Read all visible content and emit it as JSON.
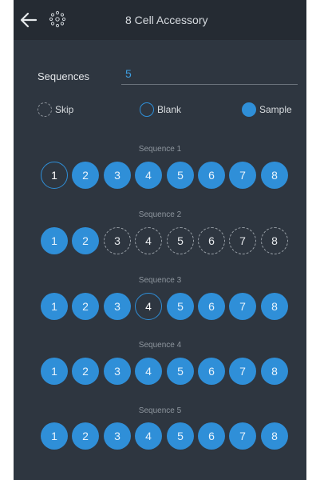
{
  "header": {
    "title": "8 Cell Accessory",
    "back_icon": "arrow-left-icon",
    "app_icon": "carousel-icon"
  },
  "sequences_field": {
    "label": "Sequences",
    "value": "5"
  },
  "legend": [
    {
      "state": "skip",
      "label": "Skip"
    },
    {
      "state": "blank",
      "label": "Blank"
    },
    {
      "state": "sample",
      "label": "Sample"
    }
  ],
  "colors": {
    "accent": "#2f8fd8",
    "background": "#2e3640",
    "topbar": "#252b33"
  },
  "sequences": [
    {
      "title": "Sequence  1",
      "cells": [
        {
          "label": "1",
          "state": "blank"
        },
        {
          "label": "2",
          "state": "sample"
        },
        {
          "label": "3",
          "state": "sample"
        },
        {
          "label": "4",
          "state": "sample"
        },
        {
          "label": "5",
          "state": "sample"
        },
        {
          "label": "6",
          "state": "sample"
        },
        {
          "label": "7",
          "state": "sample"
        },
        {
          "label": "8",
          "state": "sample"
        }
      ]
    },
    {
      "title": "Sequence  2",
      "cells": [
        {
          "label": "1",
          "state": "sample"
        },
        {
          "label": "2",
          "state": "sample"
        },
        {
          "label": "3",
          "state": "skip"
        },
        {
          "label": "4",
          "state": "skip"
        },
        {
          "label": "5",
          "state": "skip"
        },
        {
          "label": "6",
          "state": "skip"
        },
        {
          "label": "7",
          "state": "skip"
        },
        {
          "label": "8",
          "state": "skip"
        }
      ]
    },
    {
      "title": "Sequence  3",
      "cells": [
        {
          "label": "1",
          "state": "sample"
        },
        {
          "label": "2",
          "state": "sample"
        },
        {
          "label": "3",
          "state": "sample"
        },
        {
          "label": "4",
          "state": "blank"
        },
        {
          "label": "5",
          "state": "sample"
        },
        {
          "label": "6",
          "state": "sample"
        },
        {
          "label": "7",
          "state": "sample"
        },
        {
          "label": "8",
          "state": "sample"
        }
      ]
    },
    {
      "title": "Sequence  4",
      "cells": [
        {
          "label": "1",
          "state": "sample"
        },
        {
          "label": "2",
          "state": "sample"
        },
        {
          "label": "3",
          "state": "sample"
        },
        {
          "label": "4",
          "state": "sample"
        },
        {
          "label": "5",
          "state": "sample"
        },
        {
          "label": "6",
          "state": "sample"
        },
        {
          "label": "7",
          "state": "sample"
        },
        {
          "label": "8",
          "state": "sample"
        }
      ]
    },
    {
      "title": "Sequence  5",
      "cells": [
        {
          "label": "1",
          "state": "sample"
        },
        {
          "label": "2",
          "state": "sample"
        },
        {
          "label": "3",
          "state": "sample"
        },
        {
          "label": "4",
          "state": "sample"
        },
        {
          "label": "5",
          "state": "sample"
        },
        {
          "label": "6",
          "state": "sample"
        },
        {
          "label": "7",
          "state": "sample"
        },
        {
          "label": "8",
          "state": "sample"
        }
      ]
    }
  ]
}
